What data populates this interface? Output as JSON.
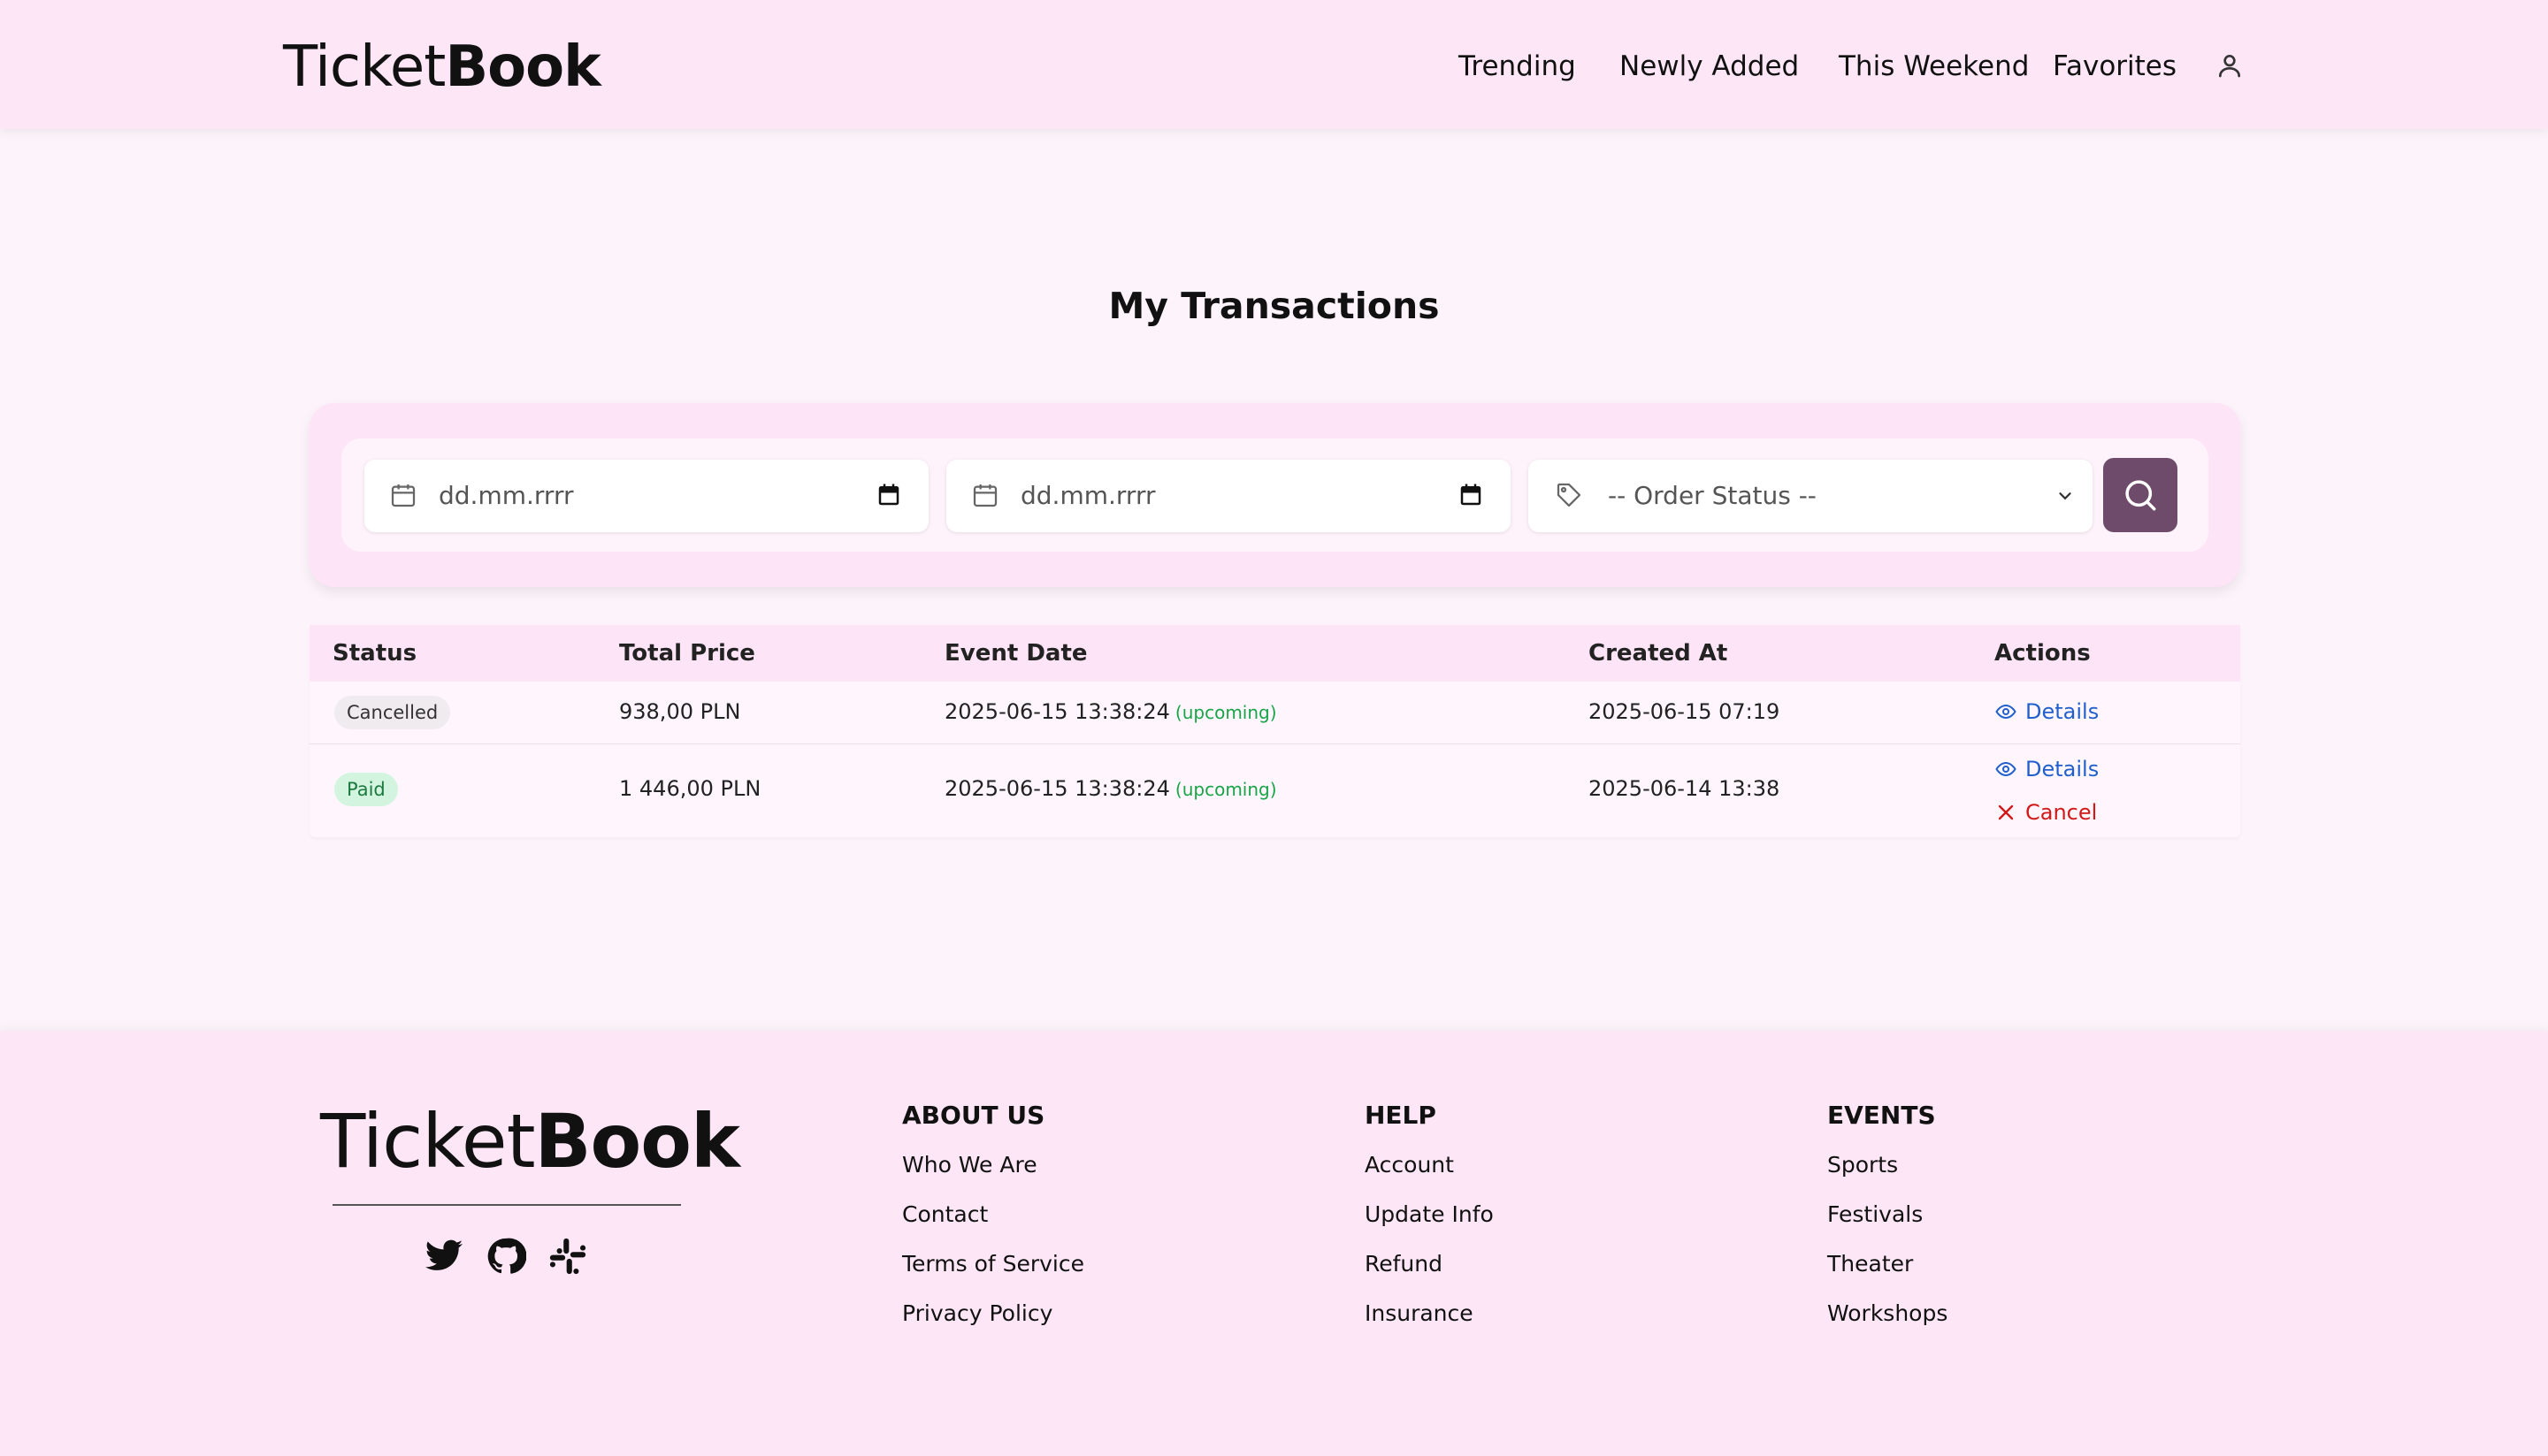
{
  "header": {
    "logo_light": "Ticket",
    "logo_bold": "Book",
    "nav": [
      "Trending",
      "Newly Added",
      "This Weekend",
      "Favorites"
    ],
    "user_icon": "user-icon"
  },
  "page": {
    "title": "My Transactions"
  },
  "filters": {
    "date_from_placeholder": "dd.mm.rrrr",
    "date_to_placeholder": "dd.mm.rrrr",
    "order_status_placeholder": "-- Order Status --",
    "search_icon": "search-icon"
  },
  "table": {
    "columns": [
      "Status",
      "Total Price",
      "Event Date",
      "Created At",
      "Actions"
    ],
    "rows": [
      {
        "status": "Cancelled",
        "total_price": "938,00 PLN",
        "event_date": "2025-06-15 13:38:24",
        "event_tag": "(upcoming)",
        "created_at": "2025-06-15 07:19",
        "actions": [
          "Details"
        ]
      },
      {
        "status": "Paid",
        "total_price": "1 446,00 PLN",
        "event_date": "2025-06-15 13:38:24",
        "event_tag": "(upcoming)",
        "created_at": "2025-06-14 13:38",
        "actions": [
          "Details",
          "Cancel"
        ]
      }
    ]
  },
  "footer": {
    "logo_light": "Ticket",
    "logo_bold": "Book",
    "social_icons": [
      "twitter-icon",
      "github-icon",
      "slack-icon"
    ],
    "columns": [
      {
        "heading": "ABOUT US",
        "links": [
          "Who We Are",
          "Contact",
          "Terms of Service",
          "Privacy Policy"
        ]
      },
      {
        "heading": "HELP",
        "links": [
          "Account",
          "Update Info",
          "Refund",
          "Insurance"
        ]
      },
      {
        "heading": "EVENTS",
        "links": [
          "Sports",
          "Festivals",
          "Theater",
          "Workshops"
        ]
      }
    ]
  },
  "colors": {
    "header_bg": "#fde7f7",
    "page_bg": "#fdf3fb",
    "search_button": "#6e4b6a",
    "details_link": "#2160cc",
    "cancel_link": "#d11919",
    "upcoming": "#18a447",
    "paid_badge": "#d3f5df"
  }
}
